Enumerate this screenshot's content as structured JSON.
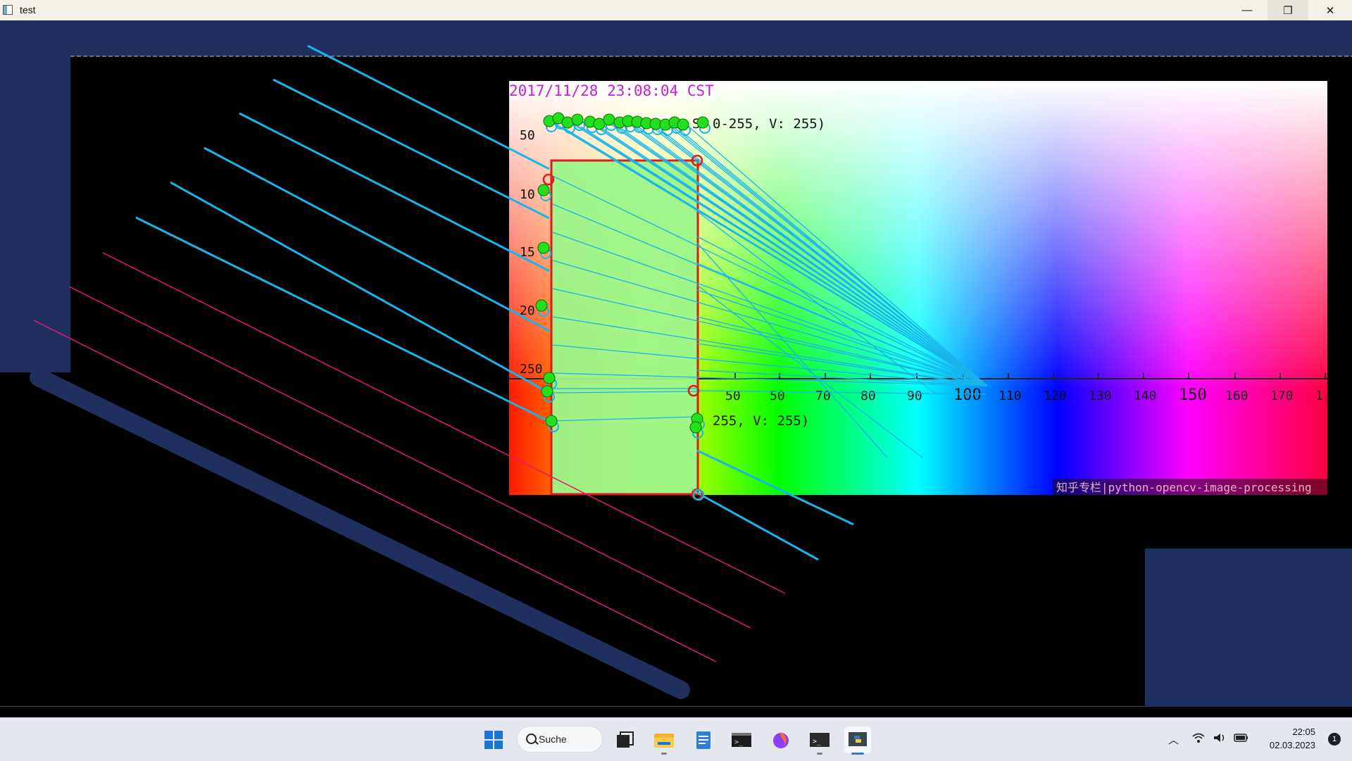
{
  "window": {
    "title": "test",
    "minimize_glyph": "—",
    "restore_glyph": "❐",
    "close_glyph": "✕"
  },
  "plot": {
    "timestamp": "2017/11/28 23:08:04 CST",
    "legend_top": "0-255, V: 255)",
    "legend_top_prefix": "S",
    "legend_bottom": "255, V: 255)",
    "watermark": "知乎专栏|python-opencv-image-processing",
    "y_ticks": [
      "50",
      "10",
      "15",
      "20",
      "250"
    ],
    "x_ticks": [
      "50",
      "50",
      "70",
      "80",
      "90",
      "100",
      "110",
      "120",
      "130",
      "140",
      "150",
      "160",
      "170",
      "1"
    ]
  },
  "taskbar": {
    "search_label": "Suche",
    "apps": [
      "windows-start-icon",
      "task-view-icon",
      "file-explorer-icon",
      "notepad-icon",
      "terminal-icon",
      "firefox-icon",
      "cmd-icon",
      "python-icon"
    ],
    "tray_icons": [
      "chevron-up-icon",
      "wifi-icon",
      "volume-icon",
      "battery-icon"
    ],
    "time": "22:05",
    "date": "02.03.2023",
    "notification_count": "1"
  },
  "colors": {
    "navy": "#1f2f5e",
    "cyan_line": "#19b4ea",
    "magenta_line": "#e0197a",
    "green_point": "#23e01c",
    "rect_red": "#e01a1a",
    "rect_fill": "#9cf58a"
  }
}
